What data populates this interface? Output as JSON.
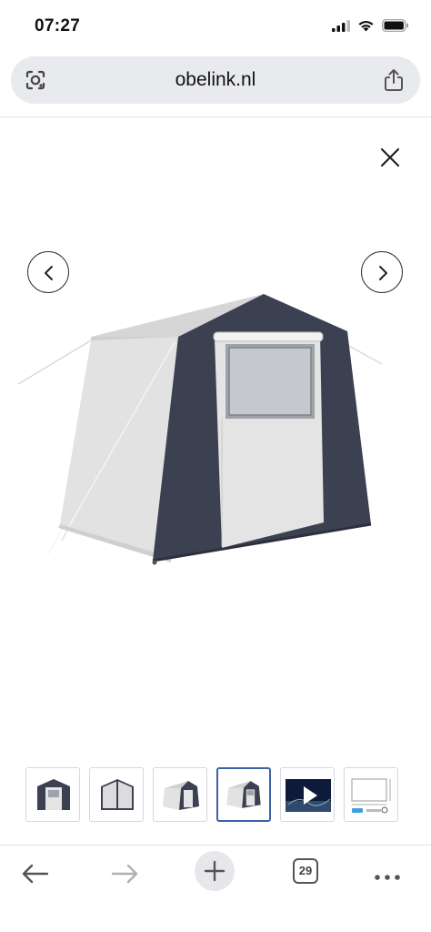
{
  "status_bar": {
    "time": "07:27",
    "icons": [
      "cellular-signal-icon",
      "wifi-icon",
      "battery-icon"
    ]
  },
  "browser": {
    "url": "obelink.nl",
    "left_icon": "lens-icon",
    "right_icon": "share-icon"
  },
  "gallery": {
    "close_icon": "close-icon",
    "prev_icon": "chevron-left-icon",
    "next_icon": "chevron-right-icon",
    "main_image": "tent-photo",
    "thumbnails": [
      {
        "kind": "image",
        "active": false
      },
      {
        "kind": "image",
        "active": false
      },
      {
        "kind": "image",
        "active": false
      },
      {
        "kind": "image",
        "active": true
      },
      {
        "kind": "video",
        "active": false
      },
      {
        "kind": "dimensions-drawing",
        "active": false
      }
    ]
  },
  "toolbar": {
    "back_icon": "back-arrow-icon",
    "forward_icon": "forward-arrow-icon",
    "new_tab_icon": "plus-icon",
    "tab_count": "29",
    "more_icon": "more-dots-icon"
  },
  "colors": {
    "url_bar_bg": "#e9eaed",
    "active_thumb_border": "#3d62a8",
    "tent_panel": "#3b4150",
    "tent_fabric": "#e3e3e3"
  }
}
